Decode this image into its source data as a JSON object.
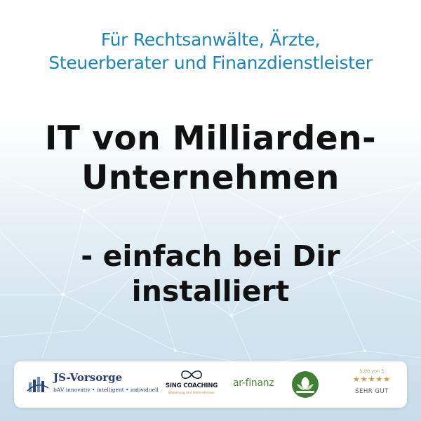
{
  "subtitle": {
    "line1": "Für Rechtsanwälte, Ärzte,",
    "line2": "Steuerberater und Finanzdienstleister"
  },
  "headline": {
    "line1": "IT von Milliarden-",
    "line2": "Unternehmen"
  },
  "tagline": {
    "line1": "- einfach bei Dir",
    "line2": "installiert"
  },
  "partners": {
    "js_vorsorge": {
      "title": "JS-Vorsorge",
      "slogan": "bAV innovativ • intelligent • individuell"
    },
    "sing_coaching": {
      "title": "SING COACHING",
      "subtitle": "Beziehung und Unternehmen"
    },
    "ar_finanz": {
      "title": "ar-finanz"
    },
    "rating": {
      "score": "5,00 von 5",
      "stars": "★★★★★",
      "label": "SEHR GUT"
    }
  },
  "colors": {
    "subtitle": "#1a86b8",
    "headline": "#111111",
    "js_blue": "#2a3f78",
    "finanz_green": "#4f8a35",
    "star_gold": "#c9a247"
  }
}
